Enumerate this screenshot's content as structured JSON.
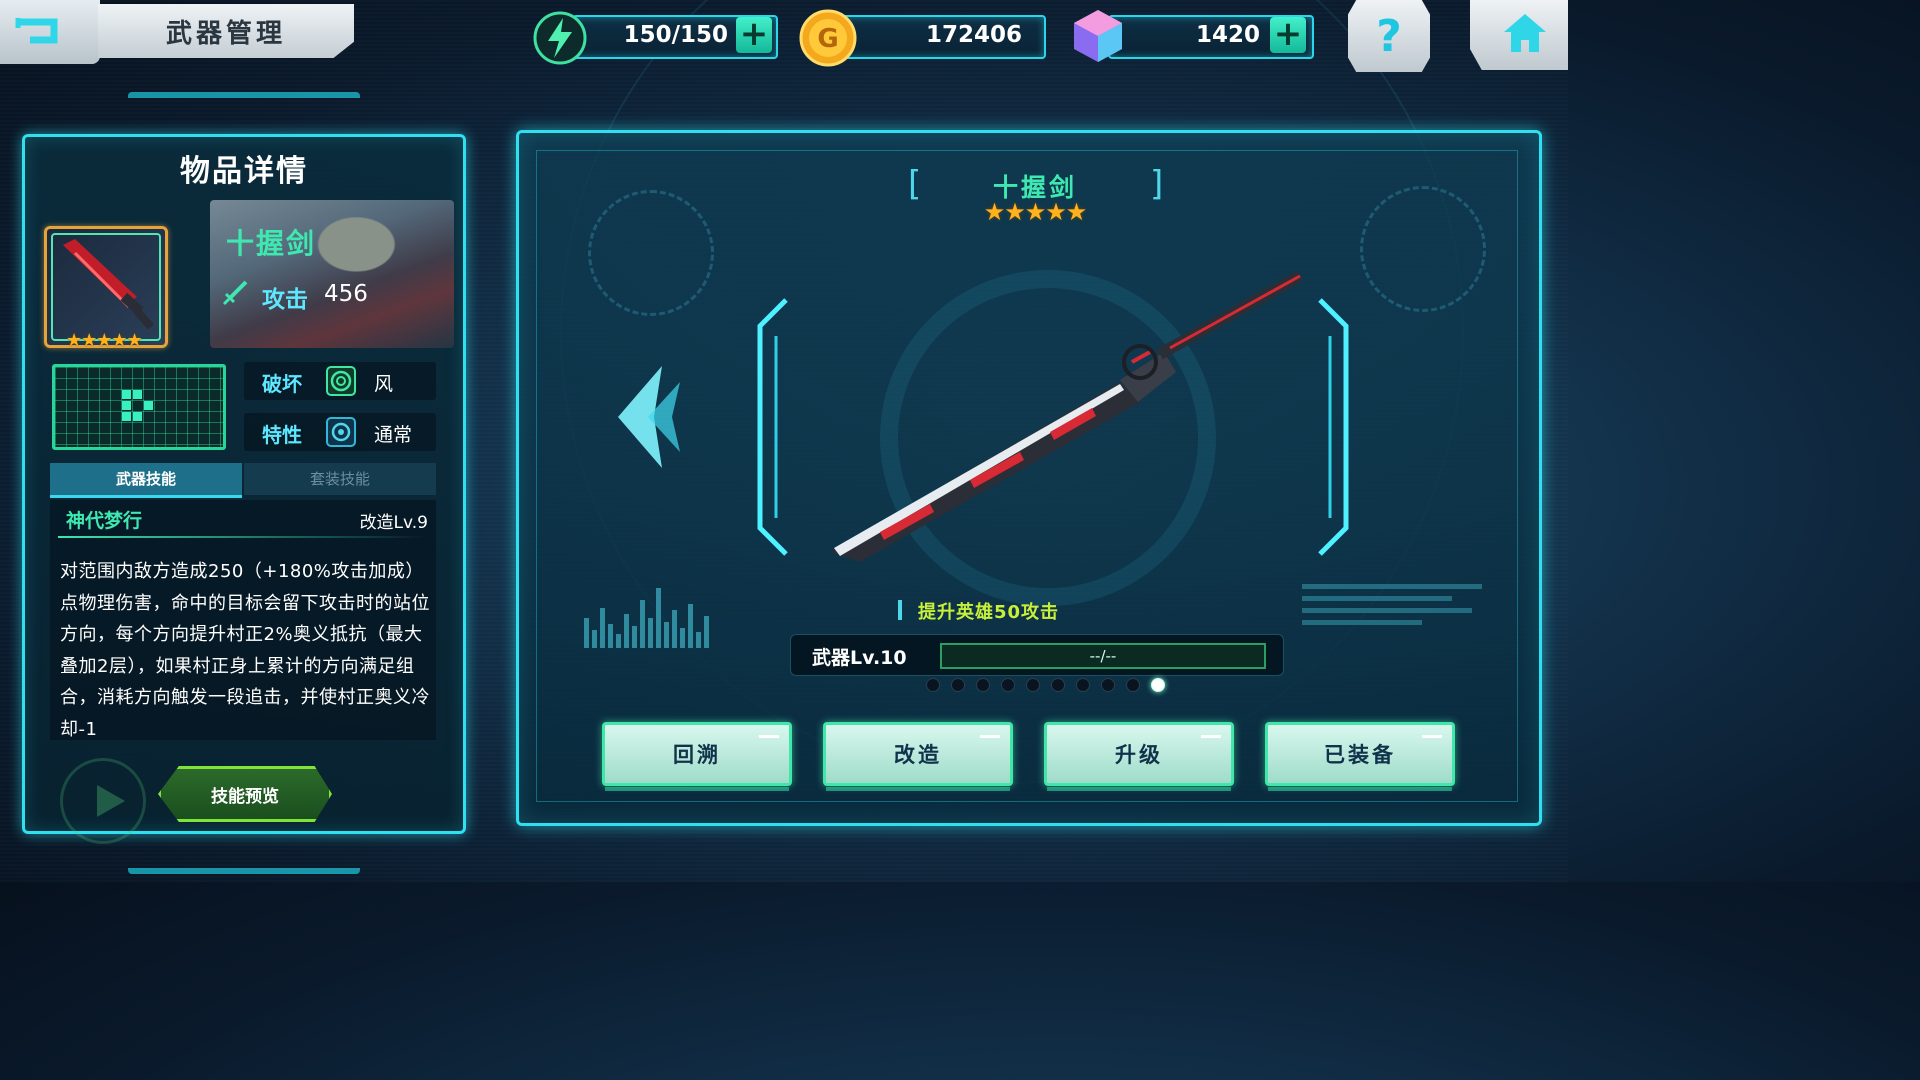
{
  "header": {
    "title": "武器管理",
    "resources": {
      "stamina": {
        "value": "150/150",
        "icon": "lightning-icon"
      },
      "gold": {
        "value": "172406",
        "icon": "gold-coin-icon"
      },
      "gems": {
        "value": "1420",
        "icon": "crystal-icon"
      }
    },
    "plus_label": "+",
    "help_label": "?"
  },
  "item_detail": {
    "panel_title": "物品详情",
    "weapon_name": "十握剑",
    "stars": "★★★★★",
    "attack_label": "攻击",
    "attack_value": "456",
    "destroy_label": "破坏",
    "destroy_value": "风",
    "trait_label": "特性",
    "trait_value": "通常",
    "tabs": {
      "weapon_skill": "武器技能",
      "set_skill": "套装技能"
    },
    "skill": {
      "name": "神代梦行",
      "level": "改造Lv.9",
      "description": "对范围内敌方造成250（+180%攻击加成）点物理伤害，命中的目标会留下攻击时的站位方向，每个方向提升村正2%奥义抵抗（最大叠加2层），如果村正身上累计的方向满足组合，消耗方向触发一段追击，并使村正奥义冷却-1"
    },
    "preview_button": "技能预览"
  },
  "weapon_view": {
    "bracket_left": "[",
    "bracket_right": "]",
    "name": "十握剑",
    "stars": "★★★★★",
    "boost_text": "提升英雄50攻击",
    "level_label": "武器Lv.10",
    "exp_text": "--/--",
    "page_dots": 10,
    "active_dot": 9,
    "buttons": [
      "回溯",
      "改造",
      "升级",
      "已装备"
    ]
  },
  "colors": {
    "accent_cyan": "#2fe0f0",
    "name_green": "#3fe8b0",
    "boost_yellow": "#c8f03a",
    "star_gold": "#ffb21e"
  }
}
